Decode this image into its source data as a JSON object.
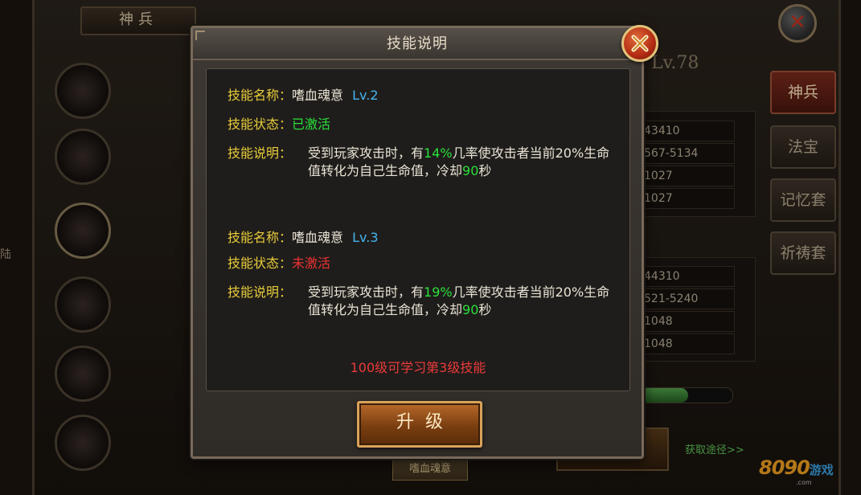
{
  "background": {
    "panel_title": "神兵",
    "level_text": "Lv.78",
    "side_tabs": [
      "神兵",
      "法宝",
      "记忆套",
      "祈祷套"
    ],
    "stats_top": [
      "43410",
      "567-5134",
      "1027",
      "1027"
    ],
    "stats_bottom": [
      "44310",
      "521-5240",
      "1048",
      "1048"
    ],
    "obtain_link": "获取途径>>",
    "bottom_label": "嗜血魂意",
    "left_edge_text": "陆",
    "xp_fill_fraction": 0.52,
    "watermark": {
      "number": "8090",
      "text": "游戏",
      "sub": ".com"
    }
  },
  "dialog": {
    "title": "技能说明",
    "close_icon": "close-x-icon",
    "skills": [
      {
        "name_label": "技能名称：",
        "name": "嗜血魂意",
        "level": "Lv.2",
        "status_label": "技能状态：",
        "status": "已激活",
        "status_color": "#29e03b",
        "desc_label": "技能说明：",
        "desc_parts": {
          "a": "受到玩家攻击时，有",
          "pct": "14%",
          "b": "几率使攻击者当前20%生命值转化为自己生命值，冷却",
          "cd": "90",
          "c": "秒"
        }
      },
      {
        "name_label": "技能名称：",
        "name": "嗜血魂意",
        "level": "Lv.3",
        "status_label": "技能状态：",
        "status": "未激活",
        "status_color": "#ea3232",
        "desc_label": "技能说明：",
        "desc_parts": {
          "a": "受到玩家攻击时，有",
          "pct": "19%",
          "b": "几率使攻击者当前20%生命值转化为自己生命值，冷却",
          "cd": "90",
          "c": "秒"
        }
      }
    ],
    "footer_note": "100级可学习第3级技能",
    "upgrade_button": "升级"
  }
}
